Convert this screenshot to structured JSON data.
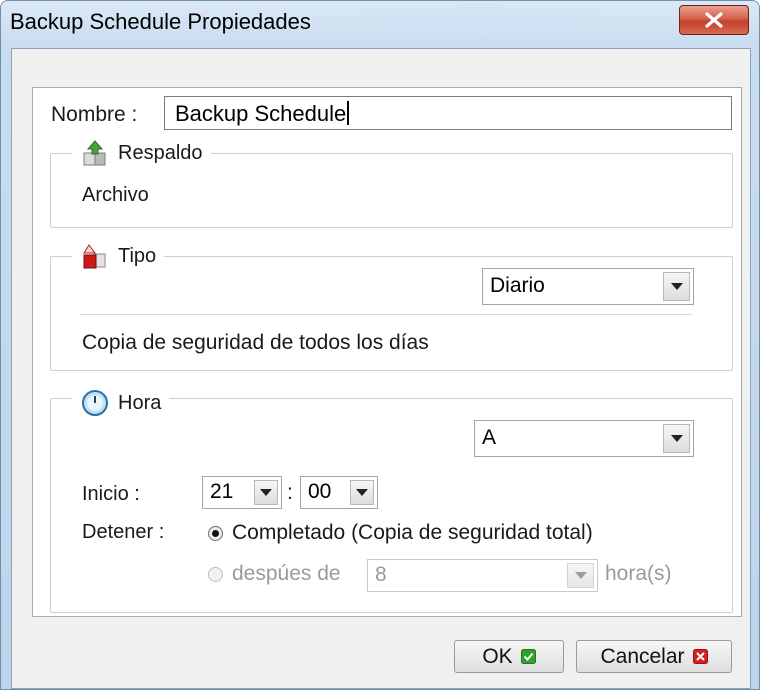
{
  "window": {
    "title": "Backup Schedule Propiedades",
    "close_label": "x"
  },
  "name": {
    "label": "Nombre :",
    "value": "Backup Schedule"
  },
  "respaldo": {
    "title": "Respaldo",
    "value": "Archivo",
    "icon": "upload-box-icon"
  },
  "tipo": {
    "title": "Tipo",
    "selected": "Diario",
    "description": "Copia de seguridad de todos los días",
    "icon": "red-box-icon"
  },
  "hora": {
    "title": "Hora",
    "selected": "A",
    "icon": "clock-icon",
    "inicio_label": "Inicio :",
    "inicio_hour": "21",
    "inicio_colon": ":",
    "inicio_minute": "00",
    "detener_label": "Detener :",
    "option_completed": "Completado (Copia de seguridad total)",
    "option_after": "despúes de",
    "after_value": "8",
    "after_unit": "hora(s)",
    "selected_option": "completed"
  },
  "buttons": {
    "ok": "OK",
    "cancel": "Cancelar"
  },
  "colors": {
    "ok_icon": "#2fa12f",
    "cancel_icon": "#d42020",
    "close_button": "#c4402a"
  }
}
